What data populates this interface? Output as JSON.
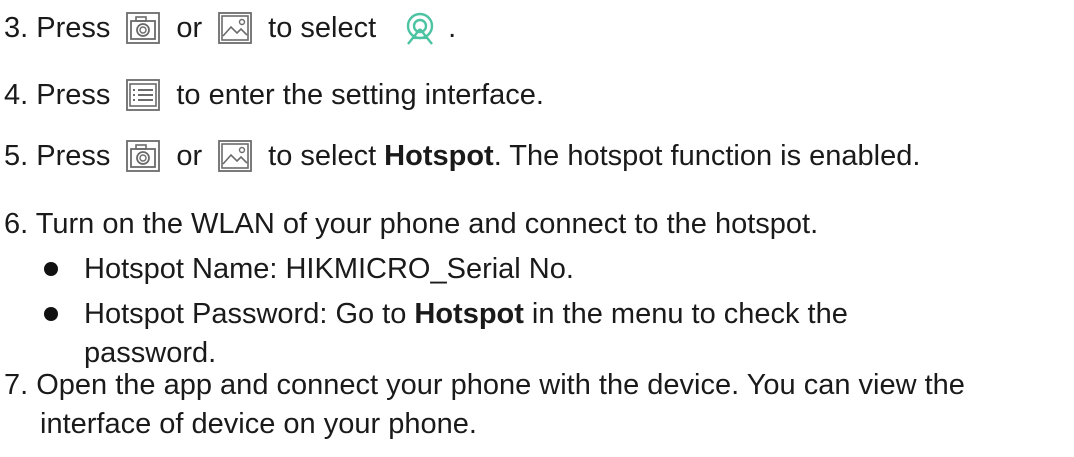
{
  "steps": {
    "s3": {
      "prefix": "3. Press",
      "or": "or",
      "mid": "to select",
      "end": "."
    },
    "s4": {
      "prefix": "4. Press",
      "rest": "to enter the setting interface."
    },
    "s5": {
      "prefix": "5. Press",
      "or": "or",
      "mid": "to select",
      "bold": "Hotspot",
      "rest": ". The hotspot function is enabled."
    },
    "s6": {
      "text": "6. Turn on the WLAN of your phone and connect to the hotspot.",
      "bullet1": "Hotspot Name: HIKMICRO_Serial No.",
      "bullet2_pre": "Hotspot Password: Go to",
      "bullet2_bold": "Hotspot",
      "bullet2_rest": "in the menu to check the",
      "bullet2_cont": "password."
    },
    "s7": {
      "line1": "7. Open the app and connect your phone with the device. You can view the",
      "line2": "interface of device on your phone."
    }
  },
  "icons": {
    "camera": "camera-button-icon",
    "gallery": "gallery-button-icon",
    "menu": "menu-button-icon",
    "hotspot": "hotspot-icon",
    "hotspot_color": "#4cc3a2"
  }
}
